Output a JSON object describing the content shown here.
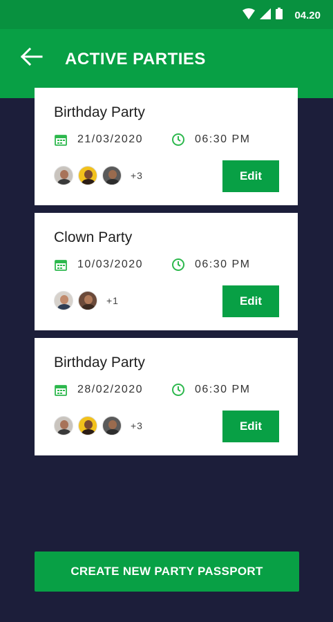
{
  "status_bar": {
    "time": "04.20"
  },
  "header": {
    "title": "ACTIVE PARTIES"
  },
  "parties": [
    {
      "title": "Birthday Party",
      "date": "21/03/2020",
      "time": "06:30 PM",
      "extra_guests": "+3",
      "edit_label": "Edit"
    },
    {
      "title": "Clown Party",
      "date": "10/03/2020",
      "time": "06:30 PM",
      "extra_guests": "+1",
      "edit_label": "Edit"
    },
    {
      "title": "Birthday Party",
      "date": "28/02/2020",
      "time": "06:30 PM",
      "extra_guests": "+3",
      "edit_label": "Edit"
    }
  ],
  "footer": {
    "create_label": "CREATE NEW PARTY PASSPORT"
  },
  "colors": {
    "primary": "#08a045",
    "status": "#08913f",
    "background": "#1c1e3a"
  }
}
